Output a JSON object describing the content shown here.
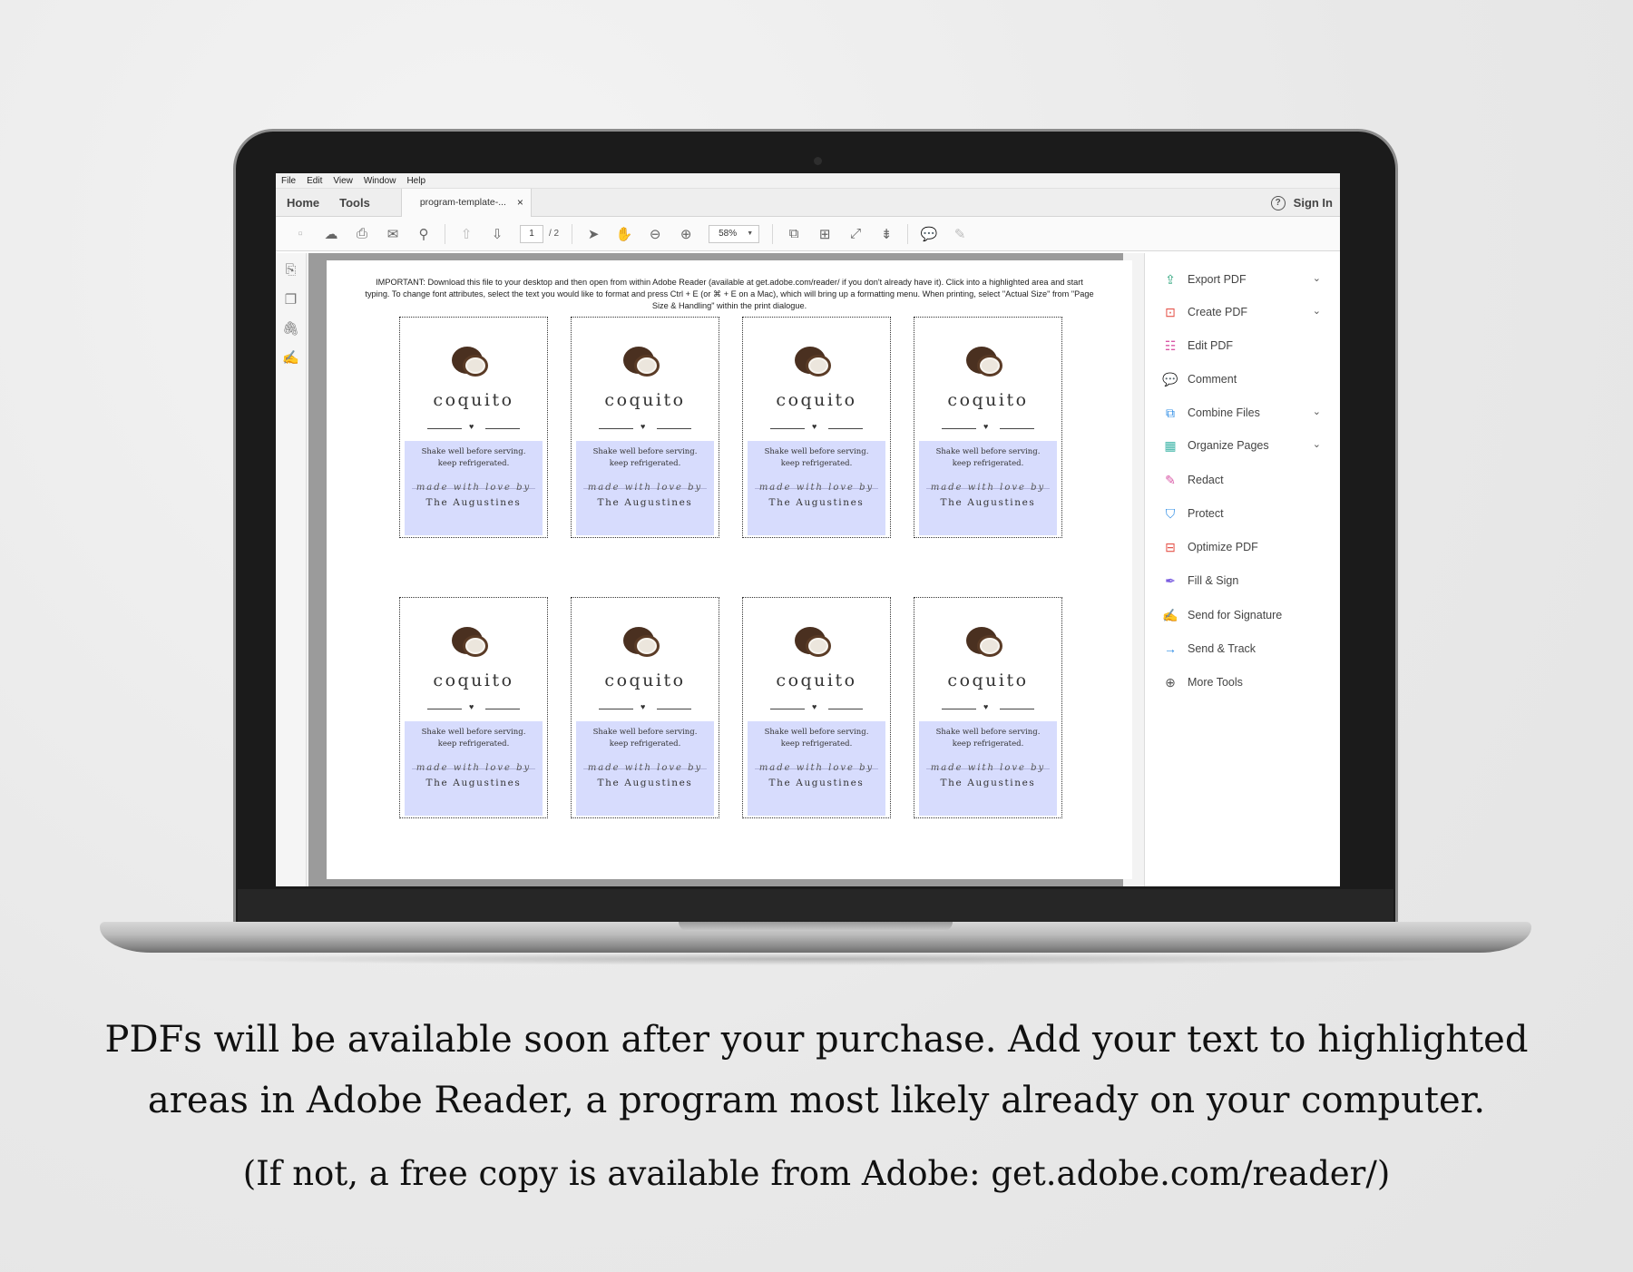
{
  "menubar": [
    "File",
    "Edit",
    "View",
    "Window",
    "Help"
  ],
  "tabs": {
    "home": "Home",
    "tools": "Tools",
    "document": "program-template-...",
    "close": "×"
  },
  "header": {
    "help": "?",
    "signin": "Sign In"
  },
  "toolbar": {
    "page_current": "1",
    "page_total": "/ 2",
    "zoom": "58%"
  },
  "document": {
    "note": "IMPORTANT:  Download this file to your desktop and then open from within Adobe Reader (available at get.adobe.com/reader/ if you don't already have it). Click into a highlighted area and start typing. To change font attributes, select the text you would like to format and press Ctrl + E (or ⌘ + E on a Mac), which will bring up a formatting menu. When printing, select \"Actual Size\" from \"Page Size & Handling\" within the print dialogue.",
    "label": {
      "title": "coquito",
      "line1": "Shake well before serving.",
      "line2": "keep refrigerated.",
      "script": "made with love by",
      "maker": "The Augustines"
    }
  },
  "tools": [
    {
      "label": "Export PDF",
      "icon": "export-pdf-icon",
      "color": "#2aa37a",
      "chevron": true
    },
    {
      "label": "Create PDF",
      "icon": "create-pdf-icon",
      "color": "#e5544b",
      "chevron": true
    },
    {
      "label": "Edit PDF",
      "icon": "edit-pdf-icon",
      "color": "#d957a6",
      "chevron": false
    },
    {
      "label": "Comment",
      "icon": "comment-icon",
      "color": "#f2b200",
      "chevron": false
    },
    {
      "label": "Combine Files",
      "icon": "combine-files-icon",
      "color": "#2d8ce5",
      "chevron": true
    },
    {
      "label": "Organize Pages",
      "icon": "organize-pages-icon",
      "color": "#3fb5a8",
      "chevron": true
    },
    {
      "label": "Redact",
      "icon": "redact-icon",
      "color": "#d957a6",
      "chevron": false
    },
    {
      "label": "Protect",
      "icon": "protect-icon",
      "color": "#2d8ce5",
      "chevron": false
    },
    {
      "label": "Optimize PDF",
      "icon": "optimize-pdf-icon",
      "color": "#e5544b",
      "chevron": false
    },
    {
      "label": "Fill & Sign",
      "icon": "fill-sign-icon",
      "color": "#7a5ce0",
      "chevron": false
    },
    {
      "label": "Send for Signature",
      "icon": "send-for-signature-icon",
      "color": "#7a5ce0",
      "chevron": false
    },
    {
      "label": "Send & Track",
      "icon": "send-track-icon",
      "color": "#2d8ce5",
      "chevron": false
    },
    {
      "label": "More Tools",
      "icon": "more-tools-icon",
      "color": "#555555",
      "chevron": false
    }
  ],
  "caption": {
    "line1": "PDFs will be available soon after your purchase. Add your text to highlighted",
    "line2": "areas in Adobe Reader, a program most likely already on your computer.",
    "line3": "(If not, a free copy is available from Adobe: get.adobe.com/reader/)"
  }
}
